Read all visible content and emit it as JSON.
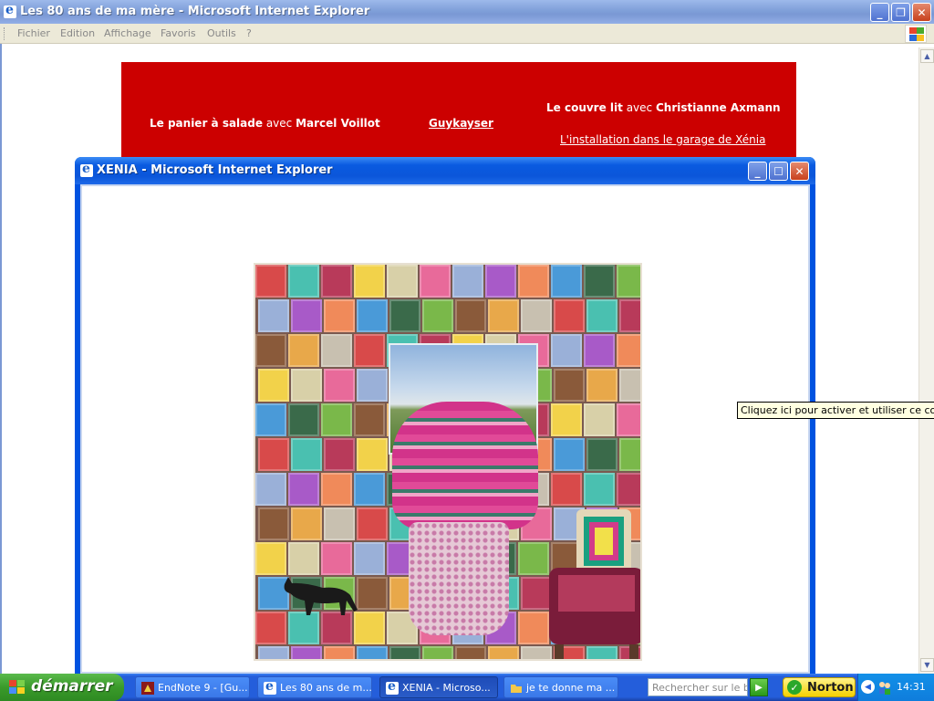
{
  "main_window": {
    "title": "Les 80 ans de ma mère - Microsoft Internet Explorer",
    "menu": [
      "Fichier",
      "Edition",
      "Affichage",
      "Favoris",
      "Outils",
      "?"
    ]
  },
  "banner": {
    "item1_bold1": "Le panier à salade",
    "item1_light": " avec ",
    "item1_bold2": "Marcel Voillot",
    "link_guykayser": "Guykayser",
    "item2_bold1": "Le couvre lit",
    "item2_light": " avec ",
    "item2_bold2": "Christianne Axmann",
    "link_installation": "L'installation dans le garage de Xénia"
  },
  "popup": {
    "title": "XENIA - Microsoft Internet Explorer"
  },
  "tooltip": "Cliquez ici pour activer et utiliser ce contrôle",
  "taskbar": {
    "start_label": "démarrer",
    "tasks": [
      {
        "label": "EndNote 9 - [Gu...",
        "icon": "endnote-icon"
      },
      {
        "label": "Les 80 ans de m...",
        "icon": "ie-icon"
      },
      {
        "label": "XENIA - Microso...",
        "icon": "ie-icon"
      },
      {
        "label": "je te donne ma ...",
        "icon": "folder-icon"
      }
    ],
    "search_placeholder": "Rechercher sur le bur",
    "norton_label": "Norton",
    "clock": "14:31"
  },
  "colors": {
    "banner_red": "#cc0000",
    "xp_blue": "#245edb",
    "start_green": "#3a9a2a"
  }
}
